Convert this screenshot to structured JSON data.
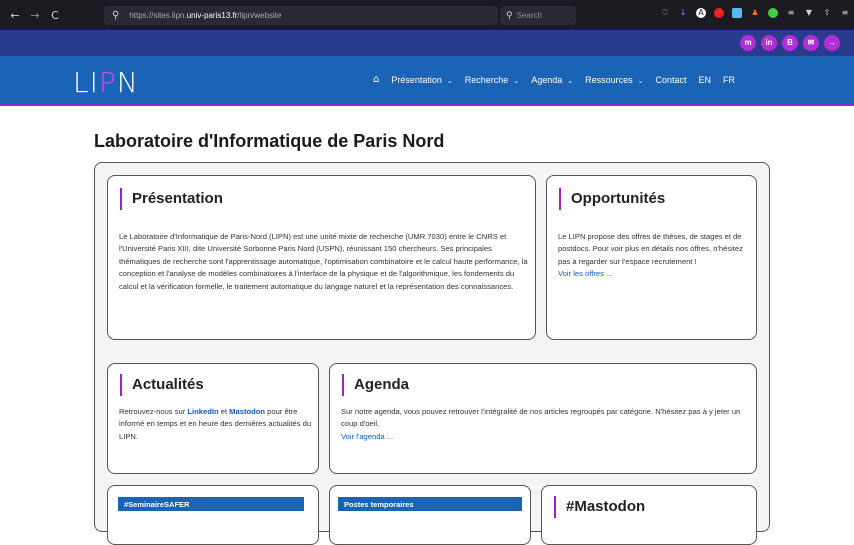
{
  "browser": {
    "url_prefix": "https://sites.lipn.",
    "url_domain": "univ-paris13.fr",
    "url_suffix": "/lipn/website",
    "search_placeholder": "Search",
    "back_icon": "←",
    "forward_icon": "→",
    "reload_icon": "C",
    "search_icon": "🔍"
  },
  "social": [
    "m",
    "in",
    "B",
    "✉",
    "→"
  ],
  "header": {
    "logo_left": "LI",
    "logo_dot": "P",
    "logo_right": "N",
    "home_icon": "⌂",
    "menu": [
      {
        "label": "Présentation",
        "chevron": "⌄"
      },
      {
        "label": "Recherche",
        "chevron": "⌄"
      },
      {
        "label": "Agenda",
        "chevron": "⌄"
      },
      {
        "label": "Ressources",
        "chevron": "⌄"
      },
      {
        "label": "Contact",
        "chevron": ""
      },
      {
        "label": "EN",
        "chevron": ""
      },
      {
        "label": "FR",
        "chevron": ""
      }
    ]
  },
  "page_title": "Laboratoire d'Informatique de Paris Nord",
  "presentation": {
    "title": "Présentation",
    "text": "Le Laboratoire d'Informatique de Paris-Nord (LIPN) est une unité mixte de recherche (UMR 7030) entre le CNRS et l'Université Paris XIII, dite Université Sorbonne Paris Nord (USPN), réunissant 150 chercheurs. Ses principales thématiques de recherche sont l'apprentissage automatique, l'optimisation combinatoire et le calcul haute performance, la conception et l'analyse de modèles combinatoires à l'interface de la physique et de l'algorithmique, les fondements du calcul et la vérification formelle, le traitement automatique du langage naturel et la représentation des connaissances."
  },
  "opportunites": {
    "title": "Opportunités",
    "text": "Le LIPN propose des offres de thèses, de stages et de postdocs. Pour voir plus en détails nos offres, n'hésitez pas à regarder sur l'espace recrutement !",
    "link": "Voir les offres ..."
  },
  "actualites": {
    "title": "Actualités",
    "text_before": "Retrouvez-nous sur ",
    "link1": "LinkedIn",
    "text_mid": " et ",
    "link2": "Mastodon",
    "text_after": " pour être informé en temps et en heure des dernières actualités du LIPN."
  },
  "agenda": {
    "title": "Agenda",
    "text": "Sur notre agenda, vous pouvez retrouver l'intégralité de nos articles regroupés par catégorie. N'hésitez pas à y jeter un coup d'oeil.",
    "link": "Voir l'agenda ..."
  },
  "bottom": {
    "banner1": "#SeminaireSAFER",
    "banner2": "Postes temporaires",
    "mastodon_title": "#Mastodon"
  }
}
